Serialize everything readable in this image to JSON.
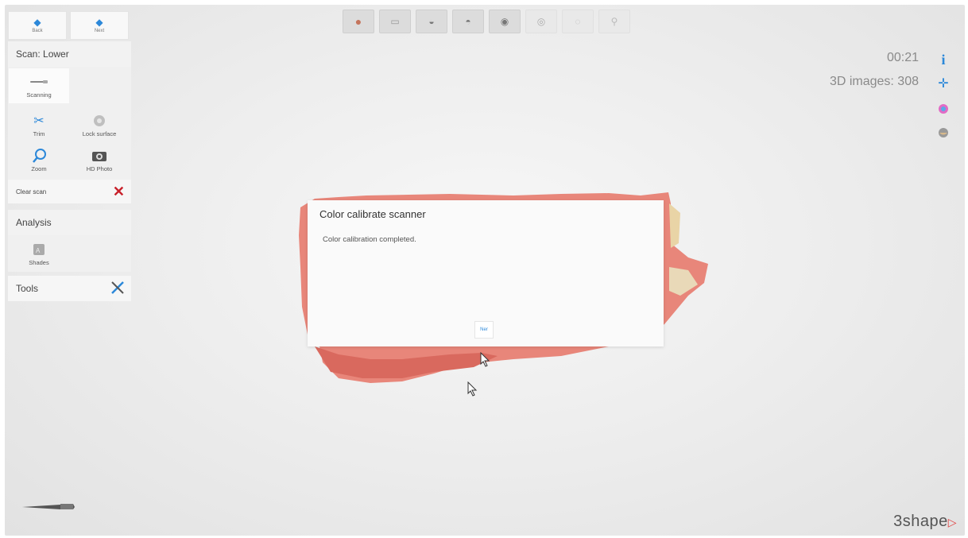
{
  "nav": {
    "back_label": "Back",
    "next_label": "Next"
  },
  "scan": {
    "header": "Scan: Lower",
    "tools": {
      "scanning": "Scanning",
      "trim": "Trim",
      "lock_surface": "Lock surface",
      "zoom": "Zoom",
      "hd_photo": "HD Photo"
    },
    "clear_scan": "Clear scan"
  },
  "analysis": {
    "header": "Analysis",
    "shades_label": "Shades"
  },
  "tools": {
    "header": "Tools"
  },
  "status": {
    "timer": "00:21",
    "images": "3D images: 308"
  },
  "dialog": {
    "title": "Color calibrate scanner",
    "message": "Color calibration completed.",
    "ok_label": "Ner"
  },
  "brand": {
    "logo_text": "3shape"
  },
  "colors": {
    "accent": "#2c88d9",
    "clear_x": "#c8202a",
    "gum": "#e8867a",
    "logo_triangle": "#e03c3c"
  }
}
